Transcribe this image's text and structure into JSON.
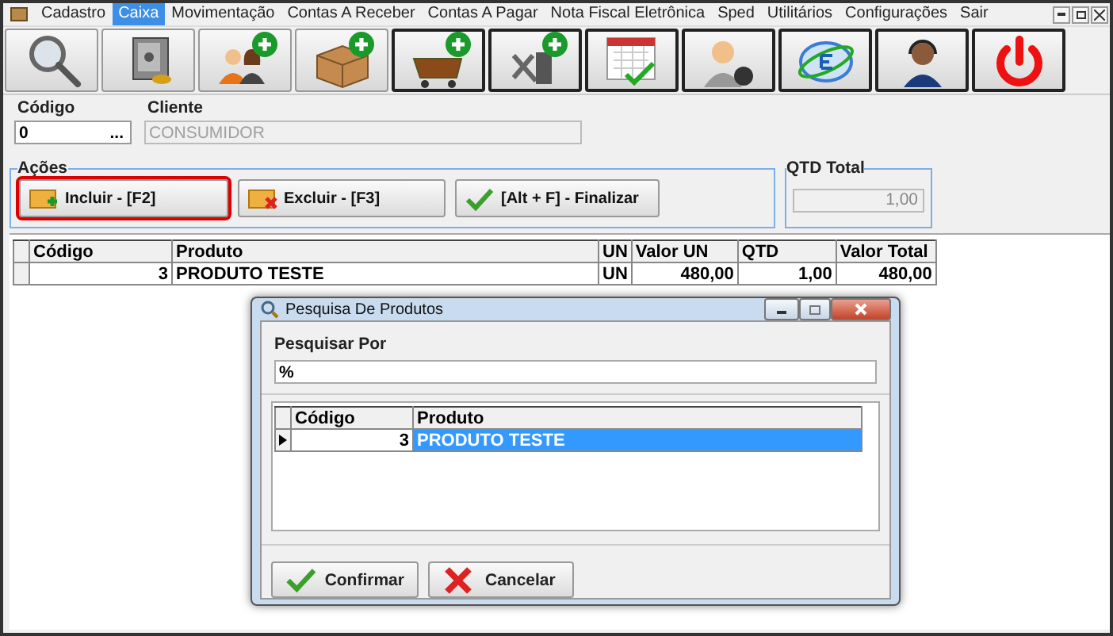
{
  "menu": [
    {
      "label": "Cadastro",
      "selected": false
    },
    {
      "label": "Caixa",
      "selected": true
    },
    {
      "label": "Movimentação",
      "selected": false
    },
    {
      "label": "Contas A Receber",
      "selected": false
    },
    {
      "label": "Contas A Pagar",
      "selected": false
    },
    {
      "label": "Nota Fiscal Eletrônica",
      "selected": false
    },
    {
      "label": "Sped",
      "selected": false
    },
    {
      "label": "Utilitários",
      "selected": false
    },
    {
      "label": "Configurações",
      "selected": false
    },
    {
      "label": "Sair",
      "selected": false
    }
  ],
  "toolbar": [
    {
      "kind": "search"
    },
    {
      "kind": "safe"
    },
    {
      "kind": "people-add"
    },
    {
      "kind": "box-add"
    },
    {
      "kind": "cart-add"
    },
    {
      "kind": "tools-add"
    },
    {
      "kind": "calendar"
    },
    {
      "kind": "user"
    },
    {
      "kind": "nfe"
    },
    {
      "kind": "support"
    },
    {
      "kind": "power"
    }
  ],
  "header": {
    "codigo": {
      "label": "Código",
      "value": "0",
      "button": "..."
    },
    "cliente": {
      "label": "Cliente",
      "value": "CONSUMIDOR",
      "disabled": true
    }
  },
  "actions": {
    "title": "Ações",
    "buttons": [
      {
        "kind": "add",
        "label": "Incluir - [F2]",
        "focused": true
      },
      {
        "kind": "delete",
        "label": "Excluir - [F3]",
        "focused": false
      },
      {
        "kind": "finish",
        "label": "[Alt + F] - Finalizar",
        "focused": false
      }
    ]
  },
  "qtd_total": {
    "title": "QTD Total",
    "value": "1,00",
    "disabled": true
  },
  "table": {
    "columns": [
      "Código",
      "Produto",
      "UN",
      "Valor UN",
      "QTD",
      "Valor Total"
    ],
    "rows": [
      {
        "selected": false,
        "cells": [
          "3",
          "PRODUTO TESTE",
          "UN",
          "480,00",
          "1,00",
          "480,00"
        ]
      }
    ]
  },
  "dialog": {
    "title": "Pesquisa De Produtos",
    "search_label": "Pesquisar Por",
    "search_value": "%",
    "table": {
      "columns": [
        "Código",
        "Produto"
      ],
      "rows": [
        {
          "selected": true,
          "cells": [
            "3",
            "PRODUTO TESTE"
          ]
        }
      ]
    },
    "buttons": [
      {
        "kind": "confirm",
        "label": "Confirmar"
      },
      {
        "kind": "cancel",
        "label": "Cancelar"
      }
    ]
  }
}
